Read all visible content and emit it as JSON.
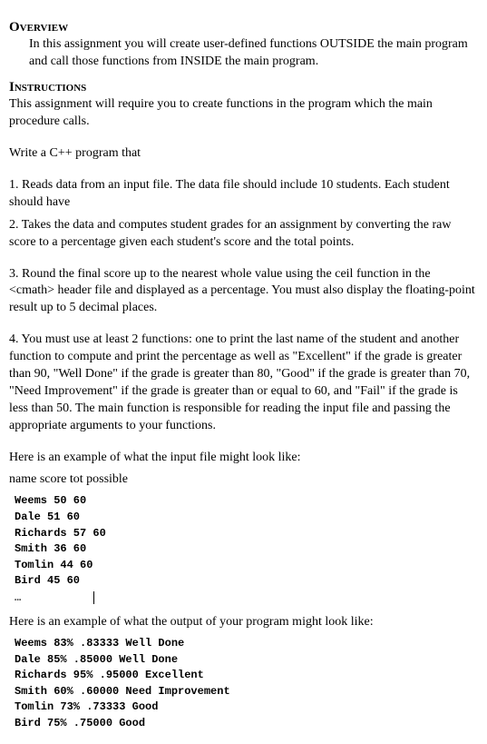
{
  "overview": {
    "heading": "Overview",
    "body": "In this assignment you will create user-defined functions OUTSIDE the main program and call those functions from INSIDE the main program."
  },
  "instructions": {
    "heading": "Instructions",
    "intro": "This assignment will require you to create functions in the program which the main procedure calls.",
    "write": "Write a C++ program that",
    "step1": "1.  Reads data from an input file.  The data file should include 10 students.  Each student should have",
    "step2": "2.  Takes the data and computes student grades for an assignment by converting the raw score to a percentage given each student's score and the total points.",
    "step3": "3.  Round the final score up to the nearest whole value using the ceil function in the <cmath> header file and displayed as a percentage. You must also display the floating-point result up to 5 decimal places.",
    "step4": "4.  You must use at least 2 functions: one to print the last name of the student and another function to compute and print the percentage as well as \"Excellent\" if the grade is greater than 90, \"Well Done\" if the grade is greater than 80, \"Good\" if the grade is greater than 70, \"Need Improvement\" if the grade is greater than or equal to 60, and \"Fail\" if the grade is less than 50. The main function is responsible for reading the input file and passing the appropriate arguments to your functions."
  },
  "example_input": {
    "lead": "Here is an example of what the input file might look like:",
    "header": "name  score  tot possible",
    "lines": [
      "Weems 50 60",
      "Dale 51 60",
      "Richards 57 60",
      "Smith 36 60",
      "Tomlin 44 60",
      "Bird 45 60"
    ],
    "ellipsis": "…"
  },
  "example_output": {
    "lead": "Here is an example of what the output of your program might look like:",
    "lines": [
      "Weems 83% .83333 Well Done",
      "Dale 85% .85000 Well Done",
      "Richards 95% .95000 Excellent",
      "Smith 60% .60000 Need Improvement",
      "Tomlin 73% .73333 Good",
      "Bird 75% .75000 Good"
    ]
  }
}
